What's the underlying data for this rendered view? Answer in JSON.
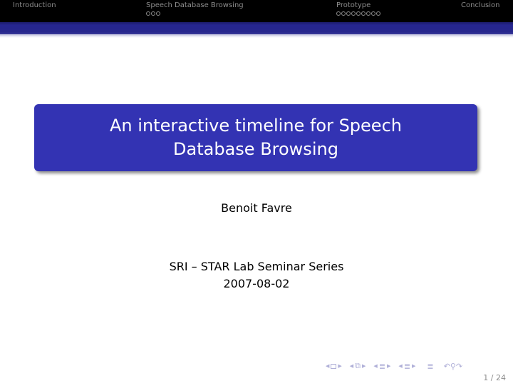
{
  "headline": {
    "sections": [
      {
        "label": "Introduction",
        "subsection_dots": 0
      },
      {
        "label": "Speech Database Browsing",
        "subsection_dots": 3
      },
      {
        "label": "Prototype",
        "subsection_dots": 9
      },
      {
        "label": "Conclusion",
        "subsection_dots": 0
      }
    ]
  },
  "title": "An interactive timeline for Speech Database Browsing",
  "author": "Benoit Favre",
  "institute": "SRI – STAR Lab Seminar Series",
  "date": "2007-08-02",
  "navigation": {
    "icons": [
      "slide-nav-icon",
      "frame-nav-icon",
      "subsection-nav-icon",
      "section-nav-icon",
      "align-icon",
      "search-back-forward-icon"
    ],
    "page": "1 / 24"
  },
  "colors": {
    "headline_bg": "#000000",
    "headline_text": "#8c8c8c",
    "bar_blue": "#27278d",
    "title_box": "#3333b3",
    "title_text": "#ffffff",
    "nav_symbols": "#b0b0d8"
  }
}
